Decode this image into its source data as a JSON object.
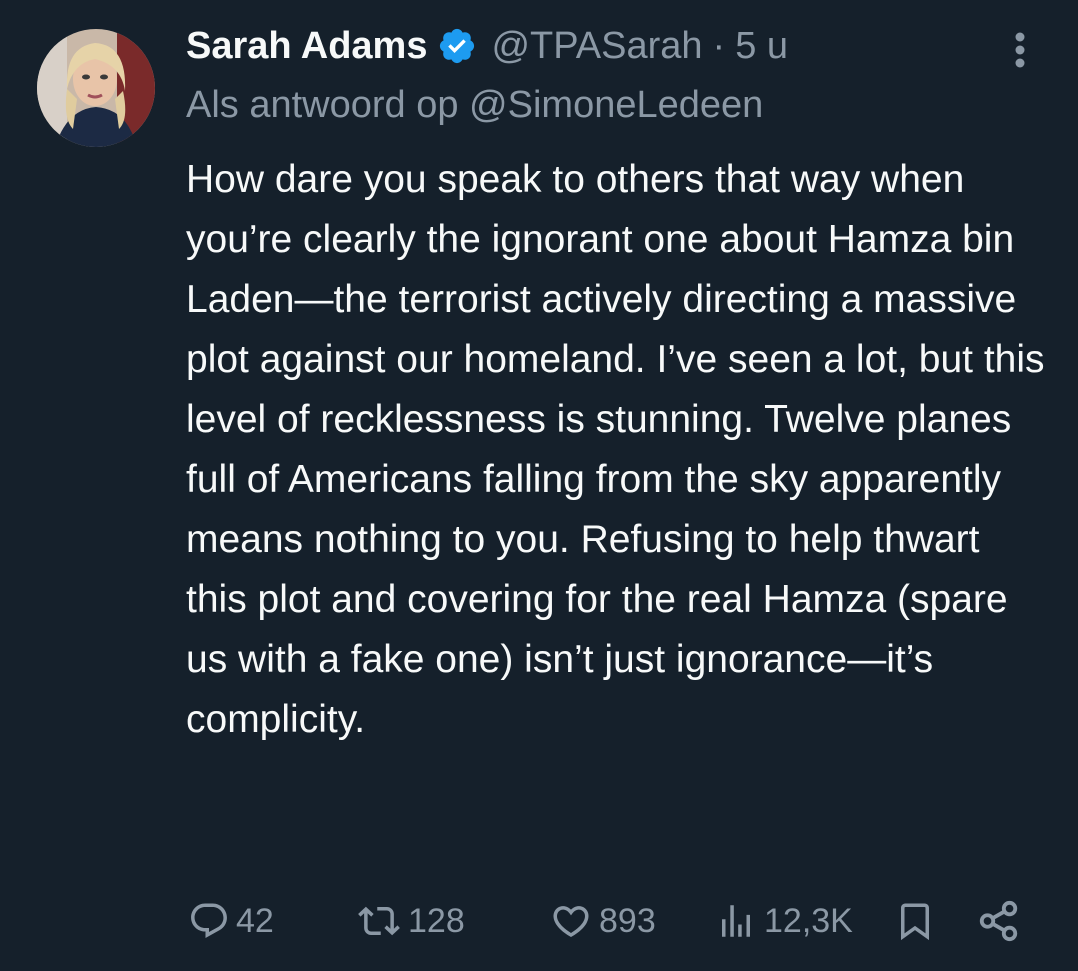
{
  "tweet": {
    "display_name": "Sarah Adams",
    "handle": "@TPASarah",
    "separator": "·",
    "time": "5 u",
    "reply_to": "Als antwoord op @SimoneLedeen",
    "text": "How dare you speak to others that way when you’re clearly the ignorant one about Hamza bin Laden—the terrorist actively directing a massive plot against our homeland. I’ve seen a lot, but this level of recklessness is stunning. Twelve planes full of Americans falling from the sky apparently means nothing to you. Refusing to help thwart this plot and covering for the real Hamza (spare us with a fake one) isn’t just ignorance—it’s complicity."
  },
  "actions": {
    "replies": "42",
    "reposts": "128",
    "likes": "893",
    "views": "12,3K"
  },
  "icons": {
    "verified": "verified-badge-icon",
    "more": "more-vertical-icon",
    "reply": "reply-icon",
    "repost": "repost-icon",
    "like": "heart-icon",
    "views": "views-chart-icon",
    "bookmark": "bookmark-icon",
    "share": "share-icon"
  },
  "colors": {
    "background": "#15202b",
    "text": "#f7f9f9",
    "secondary": "#8b98a5",
    "verified": "#1d9bf0"
  }
}
